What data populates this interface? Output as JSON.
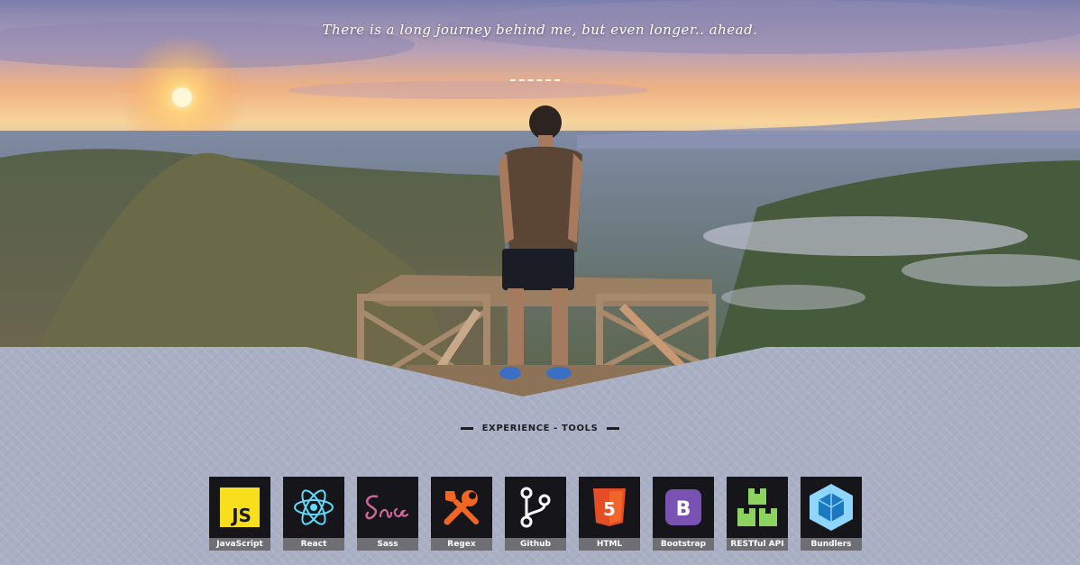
{
  "hero": {
    "quote": "There is a long journey behind me, but even longer.. ahead.",
    "colors": {
      "sky_top": "#7a7fae",
      "sky_mid": "#e9a27a",
      "sun": "#fff3c2",
      "hills": "#4e5a3a",
      "haze": "#c9c6d6"
    }
  },
  "section": {
    "title": "EXPERIENCE - TOOLS"
  },
  "tools": [
    {
      "label": "JavaScript",
      "icon": "javascript-icon",
      "color": "#f7df1e"
    },
    {
      "label": "React",
      "icon": "react-icon",
      "color": "#61dafb"
    },
    {
      "label": "Sass",
      "icon": "sass-icon",
      "color": "#cd6799"
    },
    {
      "label": "Regex",
      "icon": "regex-tools-icon",
      "color": "#f26522"
    },
    {
      "label": "Github",
      "icon": "git-branch-icon",
      "color": "#ffffff"
    },
    {
      "label": "HTML",
      "icon": "html5-icon",
      "color": "#e44d26"
    },
    {
      "label": "Bootstrap",
      "icon": "bootstrap-icon",
      "color": "#7952b3"
    },
    {
      "label": "RESTful API",
      "icon": "api-boxes-icon",
      "color": "#8dd35f"
    },
    {
      "label": "Bundlers",
      "icon": "webpack-icon",
      "color": "#8ed6fb"
    }
  ]
}
